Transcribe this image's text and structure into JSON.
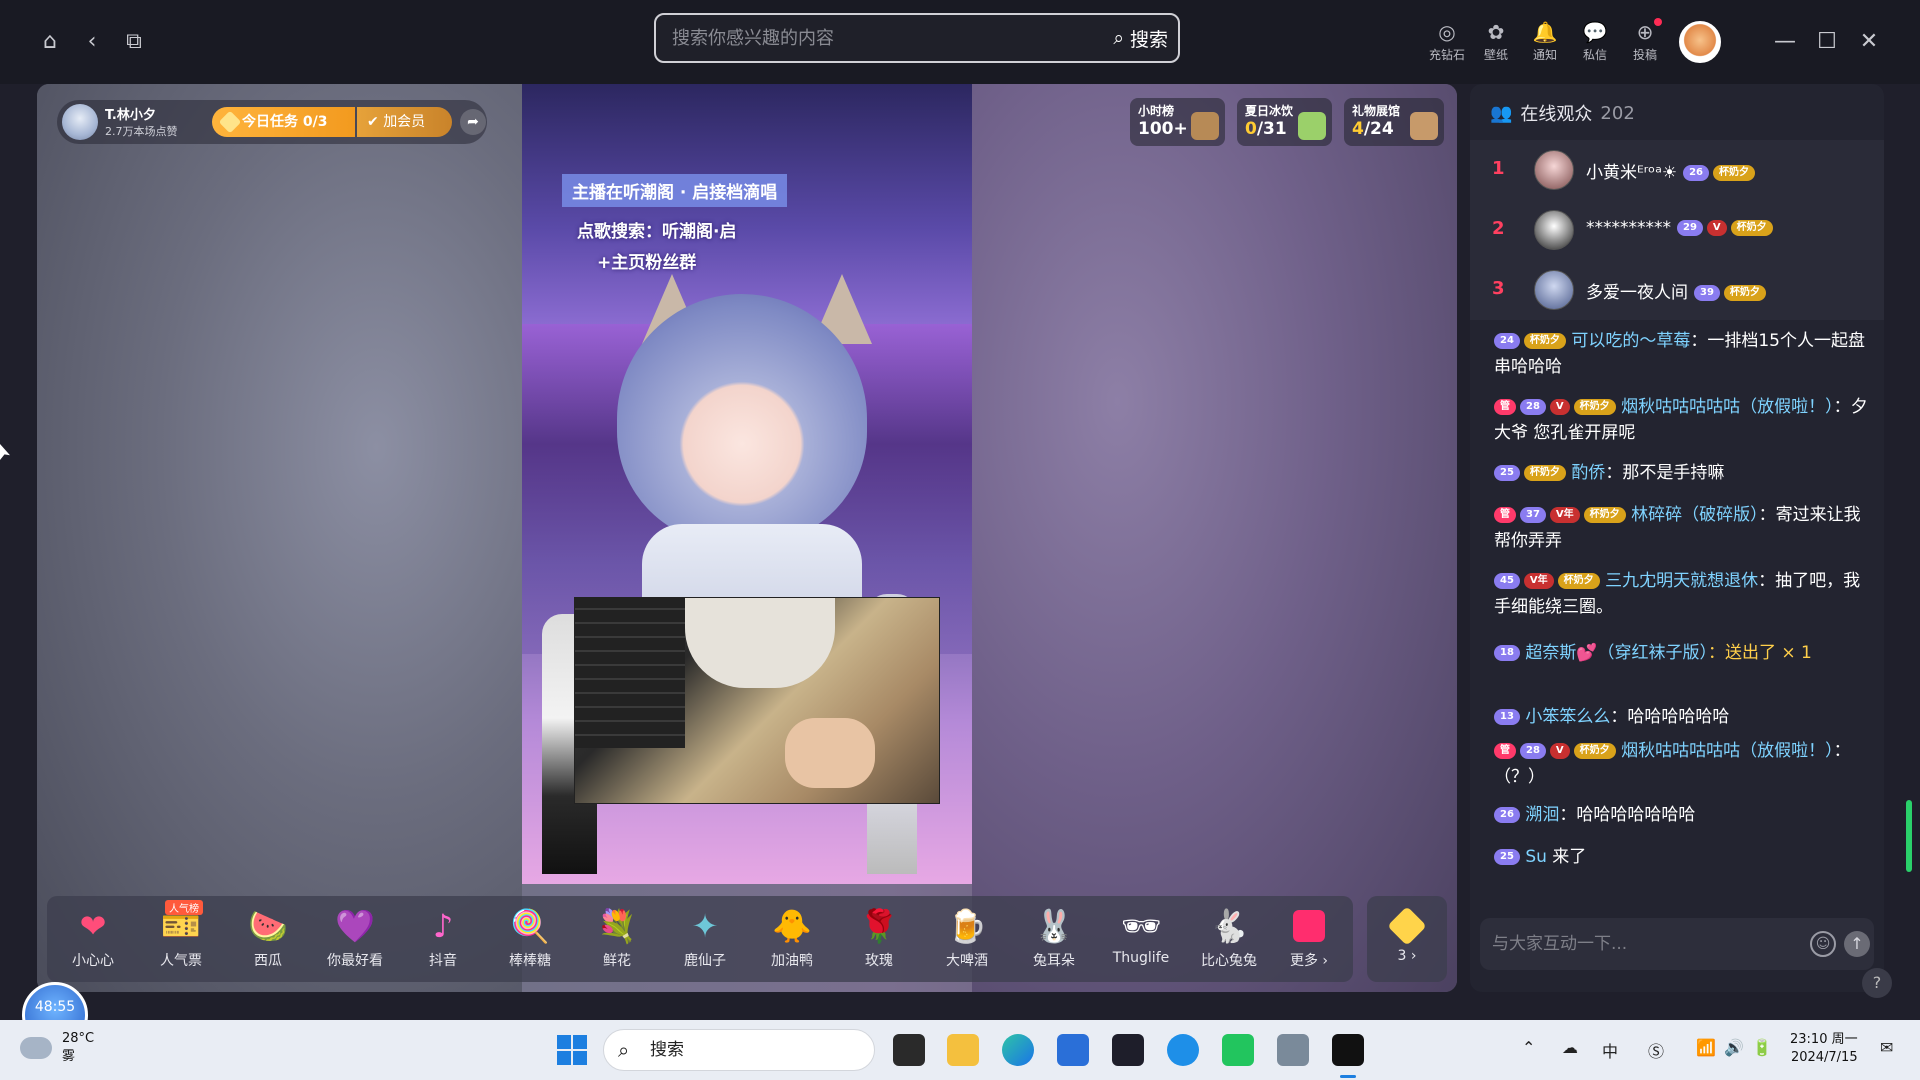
{
  "topbar": {
    "search_placeholder": "搜索你感兴趣的内容",
    "search_button": "搜索",
    "tools": [
      {
        "label": "充钻石",
        "icon": "tiktok-coin-icon"
      },
      {
        "label": "壁纸",
        "icon": "wallpaper-icon"
      },
      {
        "label": "通知",
        "icon": "bell-icon"
      },
      {
        "label": "私信",
        "icon": "message-icon"
      },
      {
        "label": "投稿",
        "icon": "upload-icon"
      }
    ]
  },
  "streamer": {
    "name": "T.林小夕",
    "likes": "2.7万本场点赞",
    "task": "今日任务 0/3",
    "member": "加会员"
  },
  "video": {
    "caption1": "主播在听潮阁 · 启接档滴唱",
    "caption2": "点歌搜索：听潮阁·启",
    "caption3": "+主页粉丝群"
  },
  "ranks": [
    {
      "title": "小时榜",
      "value": "100+",
      "highlight": ""
    },
    {
      "title": "夏日冰饮",
      "value": "/31",
      "highlight": "0"
    },
    {
      "title": "礼物展馆",
      "value": "/24",
      "highlight": "4"
    }
  ],
  "gifts": [
    {
      "name": "小心心",
      "icon": "heart-icon",
      "glyph": "❤",
      "color": "#ff4d7a",
      "badge": ""
    },
    {
      "name": "人气票",
      "icon": "ticket-icon",
      "glyph": "🎫",
      "color": "#ff8fb0",
      "badge": "人气榜"
    },
    {
      "name": "西瓜",
      "icon": "watermelon-icon",
      "glyph": "🍉",
      "color": "#ff5a5a",
      "badge": ""
    },
    {
      "name": "你最好看",
      "icon": "heart-badge-icon",
      "glyph": "💜",
      "color": "#b37bff",
      "badge": ""
    },
    {
      "name": "抖音",
      "icon": "tiktok-icon",
      "glyph": "♪",
      "color": "#ff66cc",
      "badge": ""
    },
    {
      "name": "棒棒糖",
      "icon": "lollipop-icon",
      "glyph": "🍭",
      "color": "#ff6fa8",
      "badge": ""
    },
    {
      "name": "鲜花",
      "icon": "bouquet-icon",
      "glyph": "💐",
      "color": "#ff4d4d",
      "badge": ""
    },
    {
      "name": "鹿仙子",
      "icon": "deer-antler-icon",
      "glyph": "✦",
      "color": "#6ec7d8",
      "badge": ""
    },
    {
      "name": "加油鸭",
      "icon": "duck-icon",
      "glyph": "🐥",
      "color": "#ffd23a",
      "badge": ""
    },
    {
      "name": "玫瑰",
      "icon": "rose-icon",
      "glyph": "🌹",
      "color": "#ff2a4a",
      "badge": ""
    },
    {
      "name": "大啤酒",
      "icon": "beer-icon",
      "glyph": "🍺",
      "color": "#ffc13a",
      "badge": ""
    },
    {
      "name": "兔耳朵",
      "icon": "bunny-ears-icon",
      "glyph": "🐰",
      "color": "#ffd0e0",
      "badge": ""
    },
    {
      "name": "Thuglife",
      "icon": "sunglasses-icon",
      "glyph": "🕶",
      "color": "#8a6aff",
      "badge": ""
    },
    {
      "name": "比心兔兔",
      "icon": "bunny-icon",
      "glyph": "🐇",
      "color": "#c8d8ff",
      "badge": ""
    },
    {
      "name": "更多",
      "icon": "more-gifts-icon",
      "glyph": "",
      "color": "#ff2d6e",
      "badge": ""
    }
  ],
  "wallet": {
    "count": "3"
  },
  "timer": "48:55",
  "audience": {
    "title": "在线观众",
    "count": "202",
    "top": [
      {
        "rank": "1",
        "name": "小黄米ᴱʳᵒᵃ☀",
        "level": "26",
        "fan": "杯奶夕",
        "vip": ""
      },
      {
        "rank": "2",
        "name": "**********",
        "level": "29",
        "fan": "杯奶夕",
        "vip": "V"
      },
      {
        "rank": "3",
        "name": "多爱一夜人间",
        "level": "39",
        "fan": "杯奶夕",
        "vip": ""
      }
    ]
  },
  "chat": [
    {
      "level": "24",
      "fan": "杯奶夕",
      "user": "可以吃的～草莓",
      "text": "：一排档15个人一起盘串哈哈哈",
      "gift": ""
    },
    {
      "level": "28",
      "fan": "杯奶夕",
      "user": "烟秋咕咕咕咕咕（放假啦！）",
      "text": "：夕大爷 您孔雀开屏呢",
      "gift": ""
    },
    {
      "level": "25",
      "fan": "杯奶夕",
      "user": "酌侨",
      "text": "：那不是手持嘛",
      "gift": ""
    },
    {
      "level": "37",
      "fan": "杯奶夕",
      "user": "林碎碎（破碎版）",
      "text": "：寄过来让我帮你弄弄",
      "gift": ""
    },
    {
      "level": "45",
      "fan": "杯奶夕",
      "user": "三九冘明天就想退休",
      "text": "：抽了吧，我手细能绕三圈。",
      "gift": ""
    },
    {
      "level": "18",
      "fan": "",
      "user": "超奈斯💕（穿红袜子版）",
      "text": "",
      "gift": "：送出了 × 1"
    },
    {
      "level": "13",
      "fan": "",
      "user": "小笨笨么么",
      "text": "：哈哈哈哈哈哈",
      "gift": ""
    },
    {
      "level": "28",
      "fan": "杯奶夕",
      "user": "烟秋咕咕咕咕咕（放假啦！）",
      "text": "：（？）",
      "gift": ""
    },
    {
      "level": "26",
      "fan": "",
      "user": "溯洄",
      "text": "：哈哈哈哈哈哈哈",
      "gift": ""
    },
    {
      "level": "25",
      "fan": "",
      "user": "Su",
      "text": " 来了",
      "gift": ""
    }
  ],
  "chat_input": {
    "placeholder": "与大家互动一下..."
  },
  "taskbar": {
    "temp": "28°C",
    "weather": "雾",
    "search": "搜索",
    "time": "23:10 周一",
    "date": "2024/7/15"
  }
}
